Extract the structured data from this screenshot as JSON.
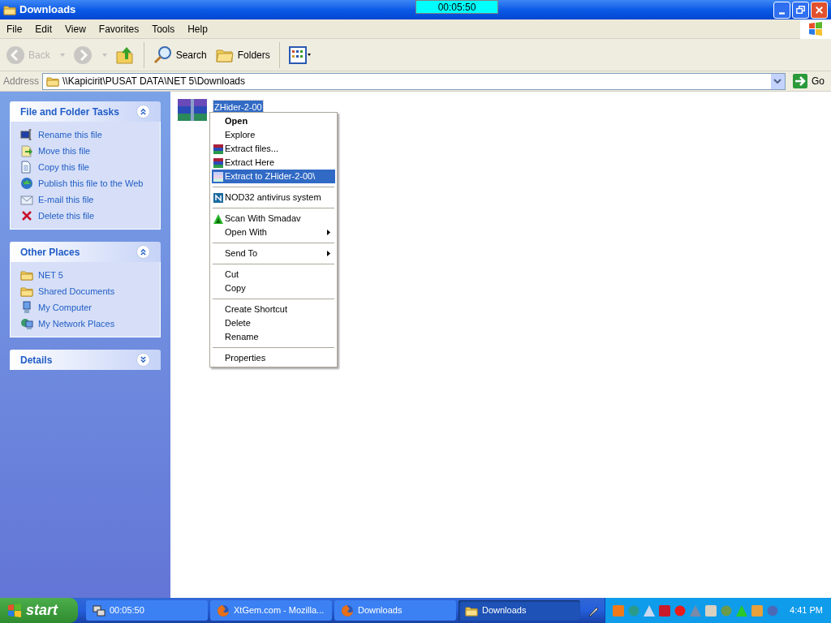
{
  "window": {
    "title": "Downloads",
    "timer": "00:05:50"
  },
  "menu_bar": [
    "File",
    "Edit",
    "View",
    "Favorites",
    "Tools",
    "Help"
  ],
  "toolbar": [
    {
      "kind": "back",
      "label": "Back",
      "disabled": true
    },
    {
      "kind": "forward",
      "disabled": true
    },
    {
      "kind": "up",
      "disabled": false
    },
    {
      "kind": "search",
      "label": "Search",
      "disabled": false
    },
    {
      "kind": "folders",
      "label": "Folders",
      "disabled": false
    },
    {
      "kind": "views",
      "disabled": false
    }
  ],
  "address": {
    "label": "Address",
    "value": "\\\\Kapicirit\\PUSAT DATA\\NET 5\\Downloads",
    "go": "Go"
  },
  "task_panes": [
    {
      "title": "File and Folder Tasks",
      "expanded": true,
      "items": [
        "Rename this file",
        "Move this file",
        "Copy this file",
        "Publish this file to the Web",
        "E-mail this file",
        "Delete this file"
      ]
    },
    {
      "title": "Other Places",
      "expanded": true,
      "items": [
        "NET 5",
        "Shared Documents",
        "My Computer",
        "My Network Places"
      ]
    },
    {
      "title": "Details",
      "expanded": false
    }
  ],
  "files": [
    {
      "name": "ZHider-2-00",
      "selected": true
    }
  ],
  "context_menu": [
    {
      "kind": "item",
      "label": "Open",
      "default": true,
      "selected": false,
      "submenu": false
    },
    {
      "kind": "item",
      "label": "Explore",
      "default": false,
      "selected": false,
      "submenu": false
    },
    {
      "kind": "item",
      "label": "Extract files...",
      "default": false,
      "selected": false,
      "submenu": false
    },
    {
      "kind": "item",
      "label": "Extract Here",
      "default": false,
      "selected": false,
      "submenu": false
    },
    {
      "kind": "item",
      "label": "Extract to ZHider-2-00\\",
      "default": false,
      "selected": true,
      "submenu": false
    },
    {
      "kind": "separator"
    },
    {
      "kind": "item",
      "label": "NOD32 antivirus system",
      "default": false,
      "selected": false,
      "submenu": false
    },
    {
      "kind": "separator"
    },
    {
      "kind": "item",
      "label": "Scan With Smadav",
      "default": false,
      "selected": false,
      "submenu": false
    },
    {
      "kind": "item",
      "label": "Open With",
      "default": false,
      "selected": false,
      "submenu": true
    },
    {
      "kind": "separator"
    },
    {
      "kind": "item",
      "label": "Send To",
      "default": false,
      "selected": false,
      "submenu": true
    },
    {
      "kind": "separator"
    },
    {
      "kind": "item",
      "label": "Cut",
      "default": false,
      "selected": false,
      "submenu": false
    },
    {
      "kind": "item",
      "label": "Copy",
      "default": false,
      "selected": false,
      "submenu": false
    },
    {
      "kind": "separator"
    },
    {
      "kind": "item",
      "label": "Create Shortcut",
      "default": false,
      "selected": false,
      "submenu": false
    },
    {
      "kind": "item",
      "label": "Delete",
      "default": false,
      "selected": false,
      "submenu": false
    },
    {
      "kind": "item",
      "label": "Rename",
      "default": false,
      "selected": false,
      "submenu": false
    },
    {
      "kind": "separator"
    },
    {
      "kind": "item",
      "label": "Properties",
      "default": false,
      "selected": false,
      "submenu": false
    }
  ],
  "taskbar": {
    "start": "start",
    "buttons": [
      {
        "label": "00:05:50",
        "selected": false
      },
      {
        "label": "XtGem.com - Mozilla...",
        "selected": false
      },
      {
        "label": "Downloads",
        "selected": false
      },
      {
        "label": "Downloads",
        "selected": true
      }
    ],
    "clock": "4:41 PM"
  }
}
